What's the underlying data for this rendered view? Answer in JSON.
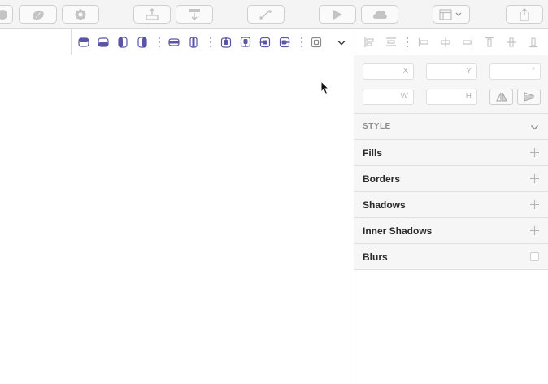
{
  "colors": {
    "accent": "#5a55a6",
    "toolbar_bg": "#f4f4f4",
    "inspector_bg": "#f6f6f6",
    "icon_gray": "#b9b9b9"
  },
  "toolbar": {
    "buttons": [
      {
        "icon": "oval-icon"
      },
      {
        "icon": "union-shape-icon"
      },
      {
        "icon": "flower-symbol-icon"
      },
      {
        "icon": "forward-layer-icon"
      },
      {
        "icon": "backward-layer-icon"
      },
      {
        "icon": "edit-path-icon"
      },
      {
        "icon": "preview-play-icon"
      },
      {
        "icon": "cloud-icon"
      },
      {
        "icon": "view-layout-icon"
      },
      {
        "icon": "export-share-icon"
      }
    ]
  },
  "inspector": {
    "position": {
      "x_label": "X",
      "y_label": "Y",
      "rotation_label": "°",
      "x_value": "",
      "y_value": "",
      "rotation_value": ""
    },
    "size": {
      "w_label": "W",
      "h_label": "H",
      "w_value": "",
      "h_value": ""
    },
    "style_header": "STYLE",
    "sections": {
      "fills": "Fills",
      "borders": "Borders",
      "shadows": "Shadows",
      "inner_shadows": "Inner Shadows",
      "blurs": "Blurs"
    }
  }
}
